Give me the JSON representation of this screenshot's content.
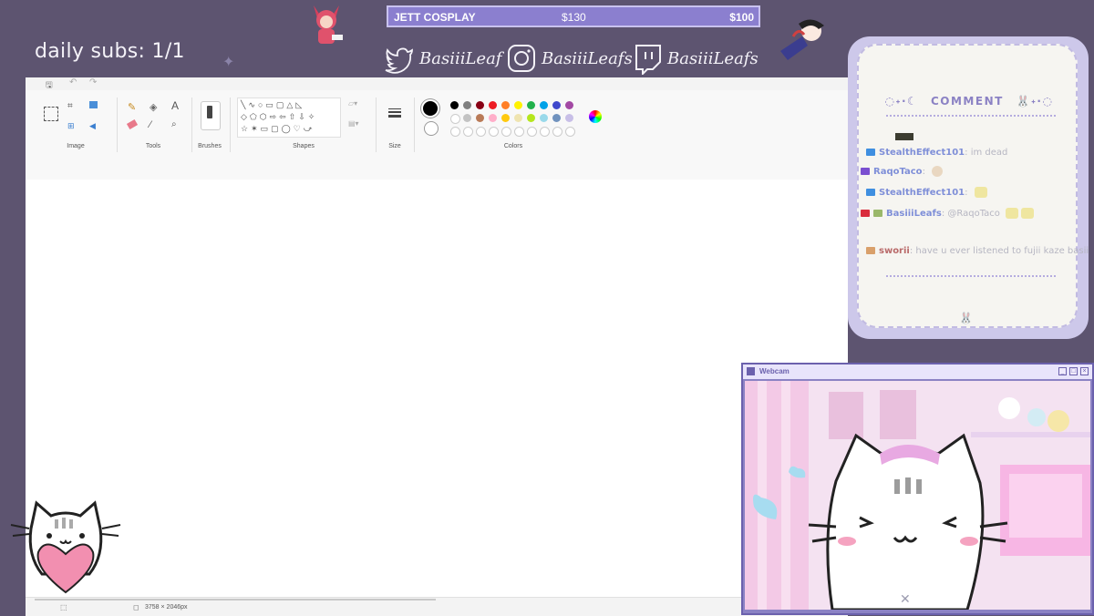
{
  "overlay": {
    "daily_subs": "daily subs: 1/1",
    "goal": {
      "name": "JETT COSPLAY",
      "current": "$130",
      "target": "$100"
    },
    "socials": [
      {
        "icon": "twitter-icon",
        "handle": "BasiiiLeaf"
      },
      {
        "icon": "instagram-icon",
        "handle": "BasiiiLeafs"
      },
      {
        "icon": "twitch-icon",
        "handle": "BasiiiLeafs"
      }
    ]
  },
  "paint": {
    "ribbon_groups": [
      "Image",
      "Tools",
      "Brushes",
      "Shapes",
      "Size",
      "Colors"
    ],
    "palette_row1": [
      "#000000",
      "#7f7f7f",
      "#880015",
      "#ed1c24",
      "#ff7f27",
      "#fff200",
      "#22b14c",
      "#00a2e8",
      "#3f48cc",
      "#a349a4"
    ],
    "palette_row2": [
      "#ffffff",
      "#c3c3c3",
      "#b97a57",
      "#ffaec9",
      "#ffc90e",
      "#efe4b0",
      "#b5e61d",
      "#99d9ea",
      "#7092be",
      "#c8bfe7"
    ],
    "status_dimensions": "3758 × 2046px"
  },
  "chat": {
    "header": "COMMENT",
    "header_left_deco": "◌˖·☾",
    "header_right_deco": "🐰˖·◌",
    "messages": [
      {
        "user": "StealthEffect101",
        "sep": ":",
        "text": "im dead",
        "badge_color": "#3f8fe0"
      },
      {
        "user": "RaqoTaco",
        "sep": ":",
        "text": "",
        "badge_color": "#7a4fd0"
      },
      {
        "user": "StealthEffect101",
        "sep": ":",
        "text": "",
        "badge_color": "#3f8fe0"
      },
      {
        "user": "BasiiiLeafs",
        "sep": ":",
        "text": "@RaqoTaco",
        "badge_color": "#d92c3c"
      },
      {
        "user": "sworii",
        "sep": ":",
        "text": "have u ever listened to fujii kaze basii",
        "badge_color": "#d9a06b"
      }
    ]
  },
  "webcam": {
    "title": "Webcam"
  }
}
